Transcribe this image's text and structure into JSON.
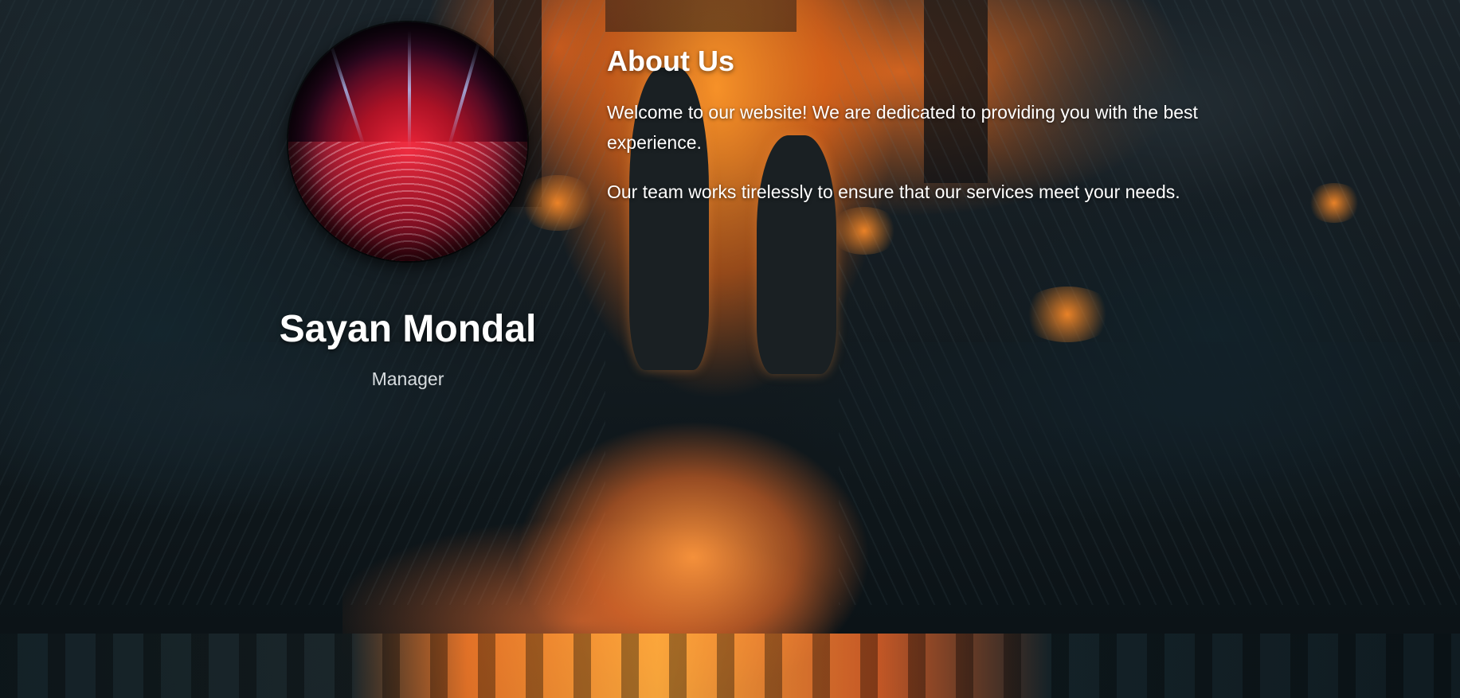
{
  "profile": {
    "avatar_icon": "concert-crowd-image",
    "name": "Sayan Mondal",
    "role": "Manager"
  },
  "about": {
    "heading": "About Us",
    "paragraphs": [
      "Welcome to our website! We are dedicated to providing you with the best experience.",
      "Our team works tirelessly to ensure that our services meet your needs."
    ]
  },
  "colors": {
    "text": "#ffffff",
    "muted_text": "#d8dde0",
    "fire_accent": "#ff9a3c",
    "shadow_blue": "#0f171b"
  }
}
